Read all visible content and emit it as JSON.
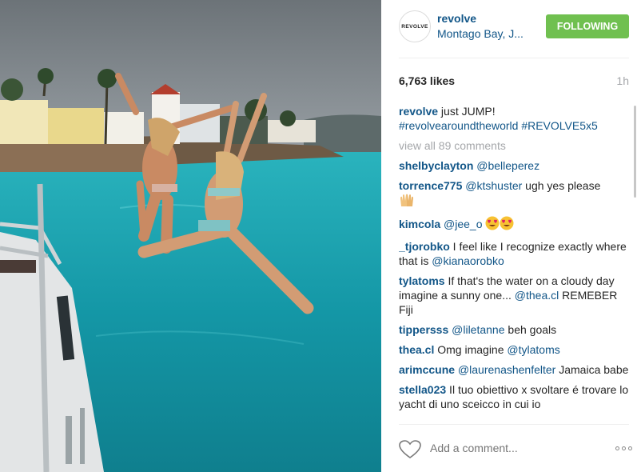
{
  "post": {
    "username": "revolve",
    "avatar_text": "REVOLVE",
    "location": "Montago Bay, J...",
    "follow_label": "FOLLOWING",
    "likes": "6,763 likes",
    "time": "1h",
    "view_all": "view all 89 comments",
    "add_comment_placeholder": "Add a comment...",
    "caption": {
      "user": "revolve",
      "text": " just JUMP!",
      "tags": "#revolvearoundtheworld #REVOLVE5x5"
    }
  },
  "comments": [
    {
      "user": "shelbyclayton",
      "tag": " @belleperez",
      "text": ""
    },
    {
      "user": "torrence775",
      "tag": " @ktshuster",
      "text": " ugh yes please",
      "emoji": "raised-hands"
    },
    {
      "user": "kimcola",
      "tag": " @jee_o",
      "text": "",
      "emoji": "heart-eyes-x2"
    },
    {
      "user": "_tjorobko",
      "text": " I feel like I recognize exactly where that is ",
      "tag_end": "@kianaorobko"
    },
    {
      "user": "tylatoms",
      "text": " If that's the water on a cloudy day imagine a sunny one... ",
      "tag_end": "@thea.cl",
      "text_end": " REMEBER Fiji"
    },
    {
      "user": "tippersss",
      "tag": " @liletanne",
      "text": " beh goals"
    },
    {
      "user": "thea.cl",
      "text": " Omg imagine ",
      "tag_end": "@tylatoms"
    },
    {
      "user": "arimccune",
      "tag": " @laurenashenfelter",
      "text": " Jamaica babe"
    },
    {
      "user": "stella023",
      "text": " Il tuo obiettivo x svoltare é trovare lo yacht di uno sceicco in cui io"
    }
  ],
  "colors": {
    "link": "#125688",
    "follow_bg": "#70c050",
    "muted": "#a5a7aa"
  },
  "icons": {
    "like": "heart-outline-icon",
    "options": "more-options-icon"
  }
}
